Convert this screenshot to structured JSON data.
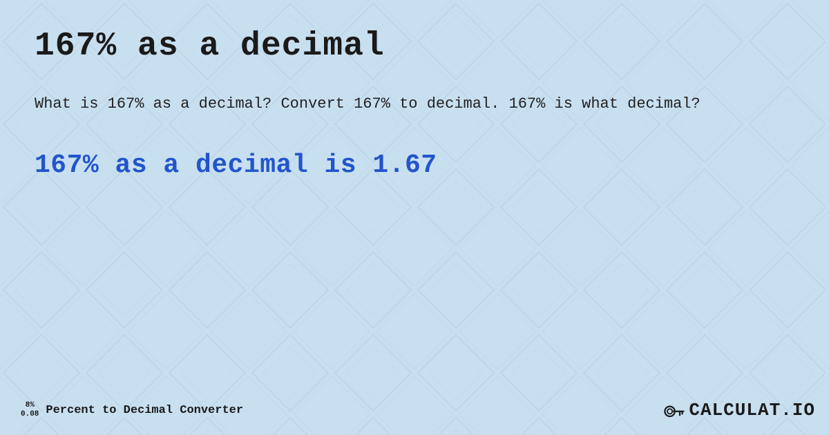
{
  "page": {
    "title": "167% as a decimal",
    "description": "What is 167% as a decimal? Convert 167% to decimal. 167% is what decimal?",
    "result": "167% as a decimal is 1.67",
    "background_color": "#c8dff0"
  },
  "footer": {
    "logo_line1": "8%",
    "logo_line2": "0.08",
    "label": "Percent to Decimal Converter",
    "brand_name": "CALCULAT.IO"
  }
}
